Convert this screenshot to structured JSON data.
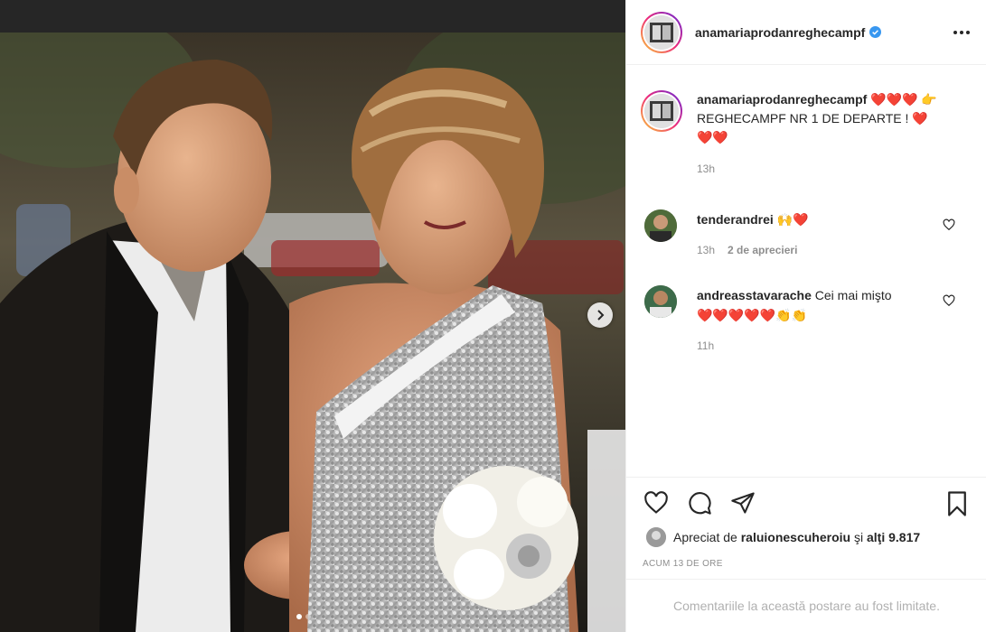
{
  "post": {
    "username": "anamariaprodanreghecampf",
    "verified": true,
    "more_label": "More options",
    "caption": {
      "hearts_lead": "❤️❤️❤️",
      "point": "👉",
      "text": "REGHECAMPF NR 1 DE DEPARTE !",
      "hearts_tail": "❤️❤️❤️",
      "time": "13h"
    },
    "comments": [
      {
        "username": "tenderandrei",
        "text": "",
        "emoji": "🙌❤️",
        "time": "13h",
        "likes": "2 de aprecieri"
      },
      {
        "username": "andreasstavarache",
        "text": "Cei mai mişto",
        "emoji": "❤️❤️❤️❤️❤️👏👏",
        "time": "11h",
        "likes": ""
      }
    ],
    "likes": {
      "prefix": "Apreciat de",
      "user": "raluionescuheroiu",
      "suffix": "şi",
      "others": "alţi 9.817"
    },
    "timestamp": "ACUM 13 DE ORE",
    "footer": "Comentariile la această postare au fost limitate."
  },
  "carousel": {
    "count": 2,
    "active": 0
  },
  "colors": {
    "verified": "#3897f0",
    "heart": "#ed4956",
    "muted": "#8e8e8e"
  },
  "icons": [
    "heart-icon",
    "comment-icon",
    "share-icon",
    "bookmark-icon",
    "more-icon",
    "chevron-right-icon",
    "verified-icon"
  ]
}
